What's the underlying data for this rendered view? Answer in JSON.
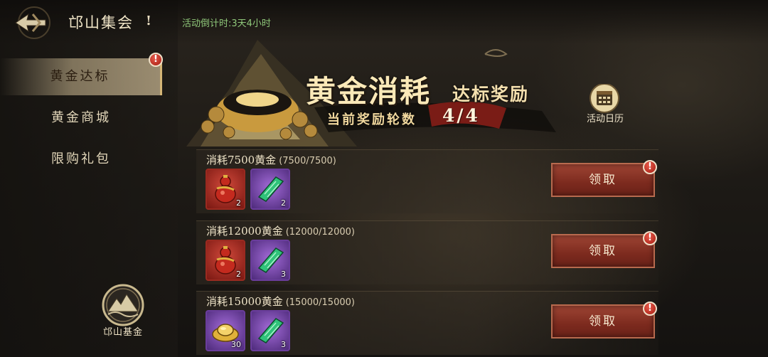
{
  "header": {
    "title": "邙山集会",
    "info_icon": "!",
    "countdown": "活动倒计时:3天4小时"
  },
  "sidebar": {
    "items": [
      {
        "label": "黄金达标",
        "active": true,
        "alert": true
      },
      {
        "label": "黄金商城",
        "active": false,
        "alert": false
      },
      {
        "label": "限购礼包",
        "active": false,
        "alert": false
      }
    ],
    "fund_label": "邙山基金"
  },
  "banner": {
    "title": "黄金消耗",
    "subtitle": "达标奖励",
    "round_label": "当前奖励轮数",
    "round_value": "4/4",
    "calendar_label": "活动日历"
  },
  "alert_mark": "!",
  "rewards": [
    {
      "title": "消耗7500黄金",
      "progress": "(7500/7500)",
      "items": [
        {
          "icon": "gourd-icon",
          "count": "2"
        },
        {
          "icon": "jade-token-icon",
          "count": "2"
        }
      ],
      "button": "领取"
    },
    {
      "title": "消耗12000黄金",
      "progress": "(12000/12000)",
      "items": [
        {
          "icon": "gourd-icon",
          "count": "2"
        },
        {
          "icon": "jade-token-icon",
          "count": "3"
        }
      ],
      "button": "领取"
    },
    {
      "title": "消耗15000黄金",
      "progress": "(15000/15000)",
      "items": [
        {
          "icon": "gold-ingot-icon",
          "count": "30"
        },
        {
          "icon": "jade-token-icon",
          "count": "3"
        }
      ],
      "button": "领取"
    }
  ],
  "colors": {
    "countdown": "#8fc77a",
    "claim_button": "#8a3222",
    "alert": "#c0281c",
    "active_tab": "#d2be96"
  }
}
